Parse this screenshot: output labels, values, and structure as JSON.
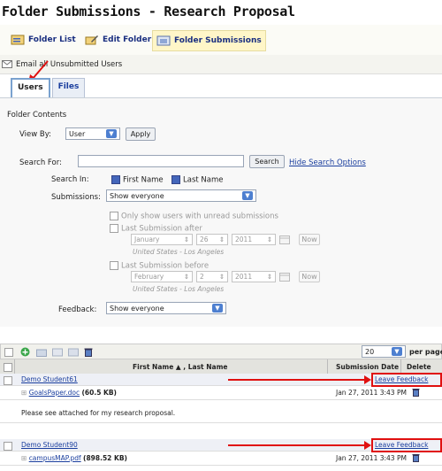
{
  "page_title": "Folder Submissions - Research Proposal",
  "toolbar": {
    "folder_list": "Folder List",
    "edit_folder": "Edit Folder",
    "folder_submissions": "Folder Submissions"
  },
  "email_link": "Email all Unsubmitted Users",
  "tabs": [
    {
      "label": "Users"
    },
    {
      "label": "Files"
    }
  ],
  "section_title": "Folder Contents",
  "view_by": {
    "label": "View By:",
    "value": "User",
    "apply": "Apply"
  },
  "search": {
    "label": "Search For:",
    "value": "",
    "button": "Search",
    "hide_options": "Hide Search Options",
    "search_in_label": "Search In:",
    "first_name": "First Name",
    "last_name": "Last Name"
  },
  "submissions": {
    "label": "Submissions:",
    "value": "Show everyone",
    "unread_only": "Only show users with unread submissions",
    "after_label": "Last Submission after",
    "after_month": "January",
    "after_day": "26",
    "after_year": "2011",
    "before_label": "Last Submission before",
    "before_month": "February",
    "before_day": "2",
    "before_year": "2011",
    "now": "Now",
    "timezone": "United States - Los Angeles"
  },
  "feedback": {
    "label": "Feedback:",
    "value": "Show everyone"
  },
  "grid": {
    "per_page_value": "20",
    "per_page_label": "per page",
    "columns": [
      "First Name ▲ , Last Name",
      "Submission Date",
      "Delete"
    ],
    "rows": [
      {
        "student": "Demo Student61",
        "feedback": "Leave Feedback",
        "file": "GoalsPaper.doc",
        "size": "(60.5 KB)",
        "date": "Jan 27, 2011 3:43 PM",
        "comment": "Please see attached for my research proposal."
      },
      {
        "student": "Demo Student90",
        "feedback": "Leave Feedback",
        "file": "campusMAP.pdf",
        "size": "(898.52 KB)",
        "date": "Jan 27, 2011 3:43 PM"
      }
    ]
  },
  "colors": {
    "accent": "#1a3e9e",
    "annotation": "#e01010"
  }
}
